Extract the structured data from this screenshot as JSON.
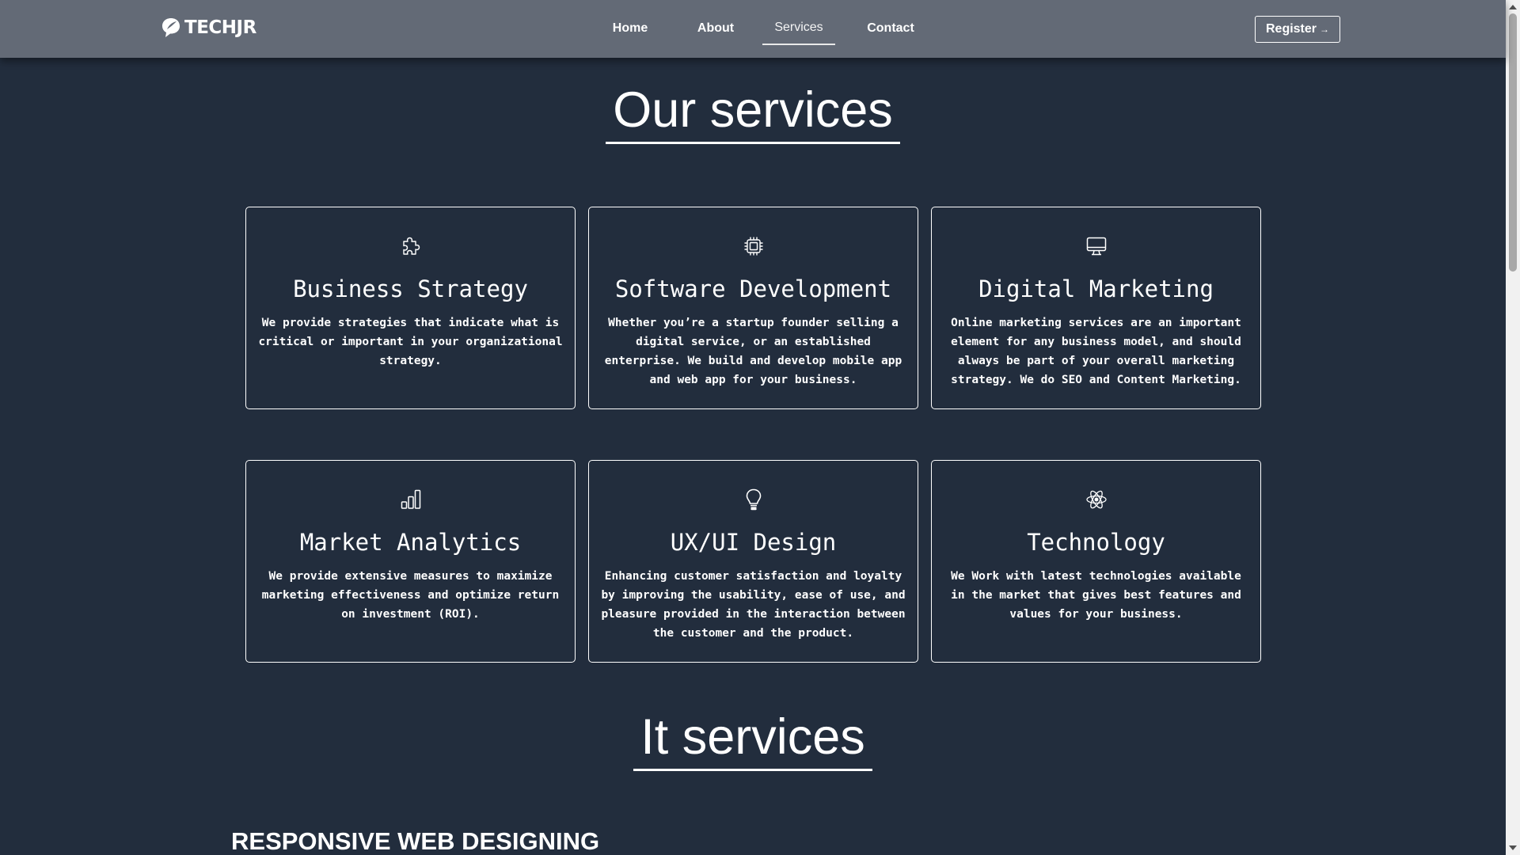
{
  "navbar": {
    "brand": "TECHJR",
    "links": [
      "Home",
      "About",
      "Services",
      "Contact"
    ],
    "active_link": "Services",
    "register_label": "Register",
    "register_icon": "arrow-right-icon"
  },
  "services_section": {
    "title": "Our services",
    "cards": [
      {
        "icon": "puzzle-icon",
        "title": "Business Strategy",
        "text": "We provide strategies that indicate what is critical or important in your organizational strategy."
      },
      {
        "icon": "cpu-chip-icon",
        "title": "Software Development",
        "text": "Whether you’re a startup founder selling a digital service, or an established enterprise. We build and develop mobile app and web app for your business."
      },
      {
        "icon": "monitor-icon",
        "title": "Digital Marketing",
        "text": "Online marketing services are an important element for any business model, and should always be part of your overall marketing strategy. We do SEO and Content Marketing."
      },
      {
        "icon": "bar-chart-icon",
        "title": "Market Analytics",
        "text": "We provide extensive measures to maximize marketing effectiveness and optimize return on investment (ROI)."
      },
      {
        "icon": "lightbulb-icon",
        "title": "UX/UI Design",
        "text": "Enhancing customer satisfaction and loyalty by improving the usability, ease of use, and pleasure provided in the interaction between the customer and the product."
      },
      {
        "icon": "atom-icon",
        "title": "Technology",
        "text": "We Work with latest technologies available in the market that gives best features and values for your business."
      }
    ]
  },
  "it_section": {
    "title": "It services",
    "subheading": "RESPONSIVE WEB DESIGNING"
  },
  "colors": {
    "background": "#222d3d",
    "navbar": "#636a76",
    "text": "#ffffff",
    "border": "#ffffff"
  }
}
